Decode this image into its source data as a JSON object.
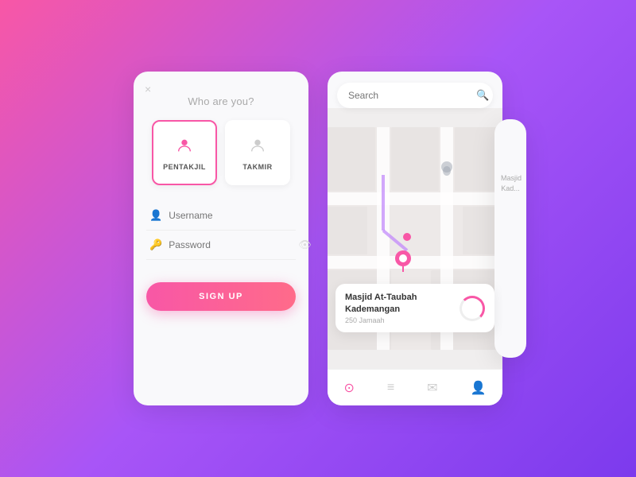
{
  "background": {
    "gradient": "linear-gradient(135deg, #f857a6 0%, #a855f7 50%, #7c3aed 100%)"
  },
  "left_card": {
    "close_label": "×",
    "title": "Who are you?",
    "roles": [
      {
        "id": "pentakjil",
        "label": "PENTAKJIL",
        "active": true
      },
      {
        "id": "takmir",
        "label": "TAKMIR",
        "active": false
      }
    ],
    "username_placeholder": "Username",
    "password_placeholder": "Password",
    "signup_label": "SIGN UP"
  },
  "right_card": {
    "search_placeholder": "Search",
    "location_name": "Masjid At-Taubah\nKademangan",
    "location_sub": "250 Jamaah",
    "nav_icons": [
      "camera",
      "list",
      "inbox",
      "person"
    ]
  }
}
